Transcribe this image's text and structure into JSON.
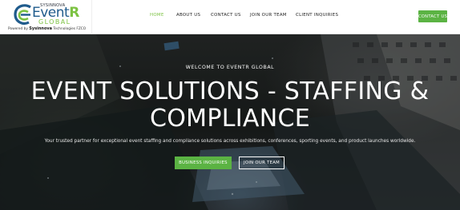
{
  "logo": {
    "sysinnova_small": "SYSINNOVA",
    "event_text": "Event",
    "event_r": "R",
    "global_text": "GLOBAL",
    "powered_prefix": "Powered by",
    "powered_brand": "Sysinnova",
    "powered_suffix": "Technologies FZCO",
    "icon": "eventr-swirl-logo"
  },
  "nav": {
    "items": [
      {
        "label": "HOME",
        "active": true
      },
      {
        "label": "ABOUT US",
        "active": false
      },
      {
        "label": "CONTACT US",
        "active": false
      },
      {
        "label": "JOIN OUR TEAM",
        "active": false
      },
      {
        "label": "CLIENT INQUIRIES",
        "active": false
      }
    ],
    "cta_label": "CONTACT US"
  },
  "hero": {
    "welcome": "WELCOME TO EVENTR GLOBAL",
    "title_line1": "EVENT SOLUTIONS - STAFFING &",
    "title_line2": "COMPLIANCE",
    "tagline": "Your trusted partner for exceptional event staffing and compliance solutions across exhibitions, conferences, sporting events, and product launches worldwide.",
    "primary_button": "BUSINESS INQUIRIES",
    "secondary_button": "JOIN OUR TEAM"
  },
  "colors": {
    "accent_green": "#5bb343",
    "logo_blue": "#1f5b8c",
    "logo_green": "#7cc242",
    "header_bg": "#ffffff"
  }
}
